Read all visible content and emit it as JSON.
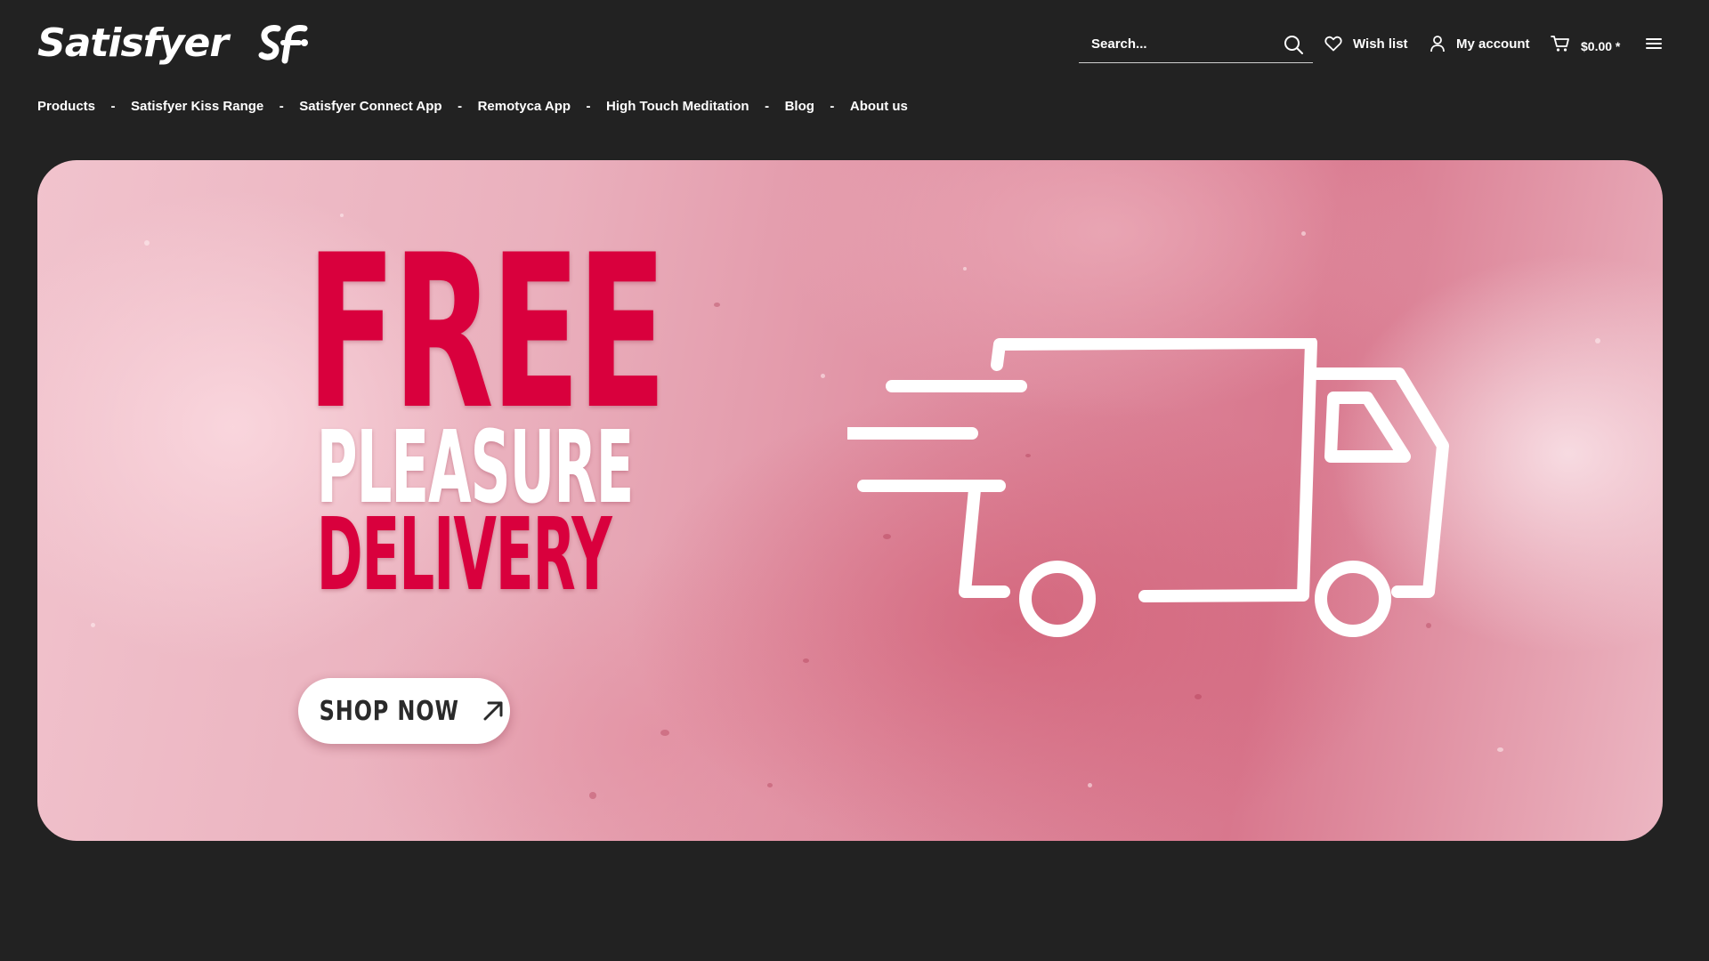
{
  "brand": {
    "name": "Satisfyer",
    "logo_mark": "SF"
  },
  "header": {
    "search_placeholder": "Search...",
    "wishlist_label": "Wish list",
    "account_label": "My account",
    "cart_total": "$0.00 *"
  },
  "nav": {
    "items": [
      {
        "label": "Products"
      },
      {
        "label": "Satisfyer Kiss Range"
      },
      {
        "label": "Satisfyer Connect App"
      },
      {
        "label": "Remotyca App"
      },
      {
        "label": "High Touch Meditation"
      },
      {
        "label": "Blog"
      },
      {
        "label": "About us"
      }
    ],
    "separator": "-"
  },
  "hero": {
    "line1": "FREE",
    "line2": "PLEASURE",
    "line3": "DELIVERY",
    "cta_label": "SHOP NOW",
    "icon": "delivery-truck-icon"
  },
  "colors": {
    "background": "#222222",
    "accent": "#d9003d",
    "hero_pink": "#df8da0"
  }
}
